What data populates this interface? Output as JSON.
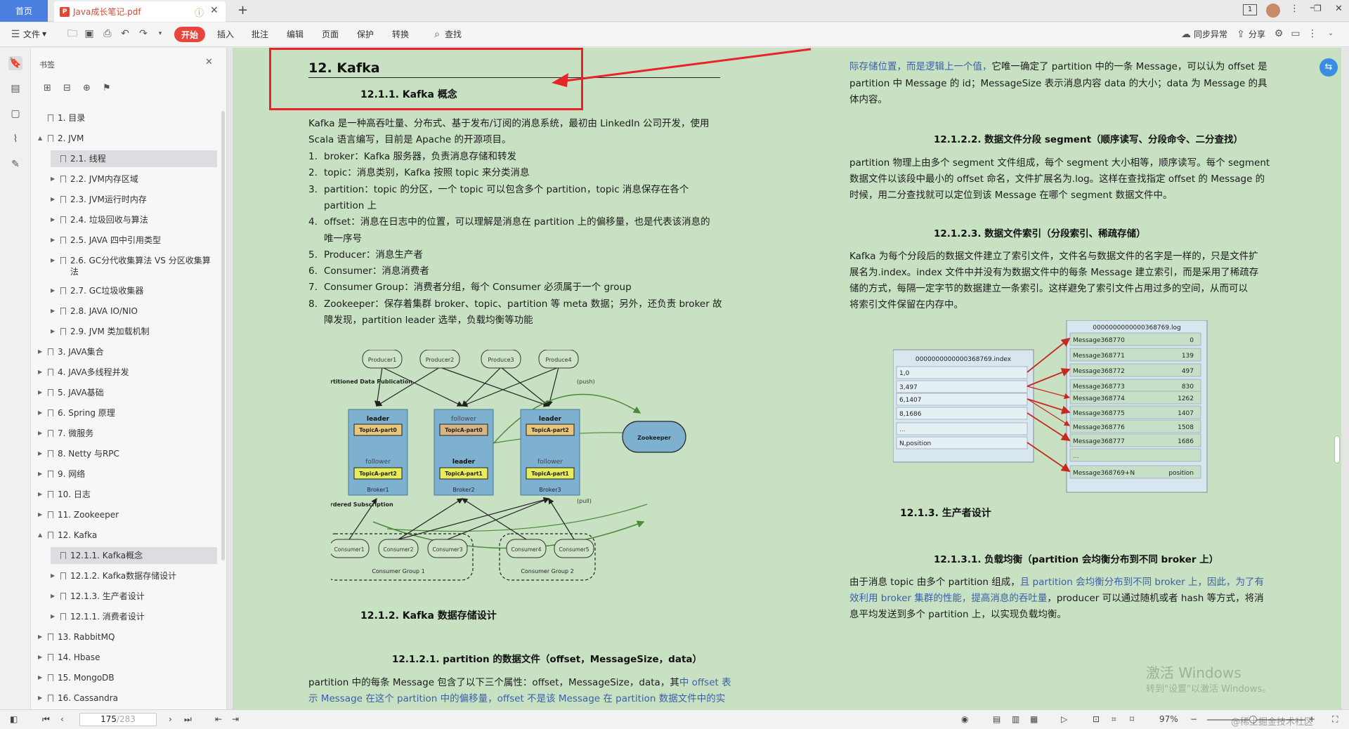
{
  "tabs": {
    "home": "首页",
    "doc": "Java成长笔记.pdf"
  },
  "toolbar": {
    "file": "文件",
    "start": "开始",
    "insert": "插入",
    "annotate": "批注",
    "edit": "编辑",
    "page": "页面",
    "protect": "保护",
    "convert": "转换",
    "search": "查找",
    "sync": "同步异常",
    "share": "分享"
  },
  "panel": {
    "title": "书签",
    "items": [
      {
        "label": "1. 目录",
        "level": 0,
        "arrow": ""
      },
      {
        "label": "2. JVM",
        "level": 0,
        "arrow": "▲"
      },
      {
        "label": "2.1. 线程",
        "level": 1,
        "arrow": ""
      },
      {
        "label": "2.2. JVM内存区域",
        "level": 1,
        "arrow": "▶"
      },
      {
        "label": "2.3. JVM运行时内存",
        "level": 1,
        "arrow": "▶"
      },
      {
        "label": "2.4. 垃圾回收与算法",
        "level": 1,
        "arrow": "▶"
      },
      {
        "label": "2.5. JAVA 四中引用类型",
        "level": 1,
        "arrow": "▶"
      },
      {
        "label": "2.6. GC分代收集算法 VS 分区收集算法",
        "level": 1,
        "arrow": "▶"
      },
      {
        "label": "2.7. GC垃圾收集器",
        "level": 1,
        "arrow": "▶"
      },
      {
        "label": "2.8.  JAVA IO/NIO",
        "level": 1,
        "arrow": "▶"
      },
      {
        "label": "2.9. JVM 类加载机制",
        "level": 1,
        "arrow": "▶"
      },
      {
        "label": "3. JAVA集合",
        "level": 0,
        "arrow": "▶"
      },
      {
        "label": "4. JAVA多线程并发",
        "level": 0,
        "arrow": "▶"
      },
      {
        "label": "5. JAVA基础",
        "level": 0,
        "arrow": "▶"
      },
      {
        "label": "6. Spring 原理",
        "level": 0,
        "arrow": "▶"
      },
      {
        "label": "7.   微服务",
        "level": 0,
        "arrow": "▶"
      },
      {
        "label": "8. Netty 与RPC",
        "level": 0,
        "arrow": "▶"
      },
      {
        "label": "9. 网络",
        "level": 0,
        "arrow": "▶"
      },
      {
        "label": "10. 日志",
        "level": 0,
        "arrow": "▶"
      },
      {
        "label": "11. Zookeeper",
        "level": 0,
        "arrow": "▶"
      },
      {
        "label": "12. Kafka",
        "level": 0,
        "arrow": "▲"
      },
      {
        "label": "12.1.1. Kafka概念",
        "level": 1,
        "arrow": ""
      },
      {
        "label": "12.1.2. Kafka数据存储设计",
        "level": 1,
        "arrow": "▶"
      },
      {
        "label": "12.1.3. 生产者设计",
        "level": 1,
        "arrow": "▶"
      },
      {
        "label": "12.1.1. 消费者设计",
        "level": 1,
        "arrow": "▶"
      },
      {
        "label": "13. RabbitMQ",
        "level": 0,
        "arrow": "▶"
      },
      {
        "label": "14. Hbase",
        "level": 0,
        "arrow": "▶"
      },
      {
        "label": "15. MongoDB",
        "level": 0,
        "arrow": "▶"
      },
      {
        "label": "16. Cassandra",
        "level": 0,
        "arrow": "▶"
      }
    ]
  },
  "left": {
    "h1": "12.   Kafka",
    "h2": "12.1.1.    Kafka 概念",
    "intro1": "Kafka 是一种高吞吐量、分布式、基于发布/订阅的消息系统，最初由 LinkedIn 公司开发，使用",
    "intro2": "Scala 语言编写，目前是 Apache 的开源项目。",
    "list": [
      {
        "n": "1.",
        "t": "broker：Kafka 服务器，负责消息存储和转发"
      },
      {
        "n": "2.",
        "t": "topic：消息类别，Kafka 按照 topic 来分类消息"
      },
      {
        "n": "3.",
        "t": "partition：topic 的分区，一个 topic 可以包含多个 partition，topic 消息保存在各个"
      },
      {
        "n": "",
        "t": "partition 上"
      },
      {
        "n": "4.",
        "t": "offset：消息在日志中的位置，可以理解是消息在 partition 上的偏移量，也是代表该消息的"
      },
      {
        "n": "",
        "t": "唯一序号"
      },
      {
        "n": "5.",
        "t": "Producer：消息生产者"
      },
      {
        "n": "6.",
        "t": "Consumer：消息消费者"
      },
      {
        "n": "7.",
        "t": "Consumer Group：消费者分组，每个 Consumer 必须属于一个 group"
      },
      {
        "n": "8.",
        "t": "Zookeeper：保存着集群 broker、topic、partition 等 meta 数据；另外，还负责 broker 故"
      },
      {
        "n": "",
        "t": "障发现，partition leader 选举，负载均衡等功能"
      }
    ],
    "h_storage": "12.1.2.     Kafka 数据存储设计",
    "h_partfile": "12.1.2.1.   partition 的数据文件（offset，MessageSize，data）",
    "p_part1_a": "partition 中的每条 Message 包含了以下三个属性：offset，MessageSize，data，其",
    "p_part1_b": "中 offset 表",
    "p_part2": "示 Message 在这个 partition 中的偏移量，offset 不是该 Message 在 partition 数据文件中的实"
  },
  "diagram1": {
    "producers": [
      "Producer1",
      "Producer2",
      "Produce3",
      "Produce4"
    ],
    "brokers": [
      {
        "name": "Broker1",
        "top": "leader",
        "topPart": "TopicA-part0",
        "bottom": "follower",
        "bottomPart": "TopicA-part2"
      },
      {
        "name": "Broker2",
        "top": "follower",
        "topPart": "TopicA-part0",
        "bottom": "leader",
        "bottomPart": "TopicA-part1"
      },
      {
        "name": "Broker3",
        "top": "leader",
        "topPart": "TopicA-part2",
        "bottom": "follower",
        "bottomPart": "TopicA-part1"
      }
    ],
    "zookeeper": "Zookeeper",
    "push": "(push)",
    "pull": "(pull)",
    "label_pub": "Partitioned Data Publication",
    "label_sub": "Ordered Subscription",
    "consumers": [
      "Consumer1",
      "Consumer2",
      "Consumer3",
      "Consumer4",
      "Consumer5"
    ],
    "groups": [
      "Consumer Group 1",
      "Consumer Group 2"
    ]
  },
  "right": {
    "p1_a": "际存储位置，而是逻辑上一个值，",
    "p1_b": "它唯一确定了 partition 中的一条 Message，可以认为 offset 是",
    "p1_c": "partition 中 Message 的 id；MessageSize 表示消息内容 data 的大小；data 为 Message 的具",
    "p1_d": "体内容。",
    "h_seg": "12.1.2.2.   数据文件分段 segment（顺序读写、分段命令、二分查找）",
    "seg1": "partition 物理上由多个 segment 文件组成，每个 segment 大小相等，顺序读写。每个 segment",
    "seg2": "数据文件以该段中最小的 offset 命名，文件扩展名为.log。这样在查找指定 offset 的 Message 的",
    "seg3": "时候，用二分查找就可以定位到该 Message 在哪个 segment 数据文件中。",
    "h_idx": "12.1.2.3.   数据文件索引（分段索引、稀疏存储）",
    "idx1": "Kafka 为每个分段后的数据文件建立了索引文件，文件名与数据文件的名字是一样的，只是文件扩",
    "idx2": "展名为.index。index 文件中并没有为数据文件中的每条 Message 建立索引，而是采用了稀疏存",
    "idx3": "储的方式，每隔一定字节的数据建立一条索引。这样避免了索引文件占用过多的空间，从而可以",
    "idx4": "将索引文件保留在内存中。",
    "h_prod": "12.1.3.     生产者设计",
    "h_lb": "12.1.3.1.   负载均衡（partition 会均衡分布到不同 broker 上）",
    "lb1_a": "由于消息 topic 由多个 partition 组成，",
    "lb1_b": "且 partition 会均衡分布到不同 broker 上，因此，为了有",
    "lb2_a": "效利用 broker 集群的性能，提高消息的吞吐量",
    "lb2_b": "，producer 可以通过随机或者 hash 等方式，将消",
    "lb3": "息平均发送到多个 partition 上，以实现负载均衡。"
  },
  "diagram2": {
    "index_file": "0000000000000368769.index",
    "index_rows": [
      "1,0",
      "3,497",
      "6,1407",
      "8,1686",
      "...",
      "N,position"
    ],
    "log_file": "0000000000000368769.log",
    "log_rows": [
      {
        "m": "Message368770",
        "v": "0"
      },
      {
        "m": "Message368771",
        "v": "139"
      },
      {
        "m": "Message368772",
        "v": "497"
      },
      {
        "m": "Message368773",
        "v": "830"
      },
      {
        "m": "Message368774",
        "v": "1262"
      },
      {
        "m": "Message368775",
        "v": "1407"
      },
      {
        "m": "Message368776",
        "v": "1508"
      },
      {
        "m": "Message368777",
        "v": "1686"
      },
      {
        "m": "...",
        "v": ""
      },
      {
        "m": "Message368769+N",
        "v": "position"
      }
    ]
  },
  "watermark": {
    "l1": "激活 Windows",
    "l2": "转到\"设置\"以激活 Windows。"
  },
  "status": {
    "page": "175",
    "total": "/283",
    "zoom": "97%",
    "credit": "@稀土掘金技术社区"
  },
  "colors": {
    "accent": "#4a7fe0",
    "start": "#e8453c",
    "page_bg": "#c9e1c3",
    "highlight": "#e8242a"
  }
}
